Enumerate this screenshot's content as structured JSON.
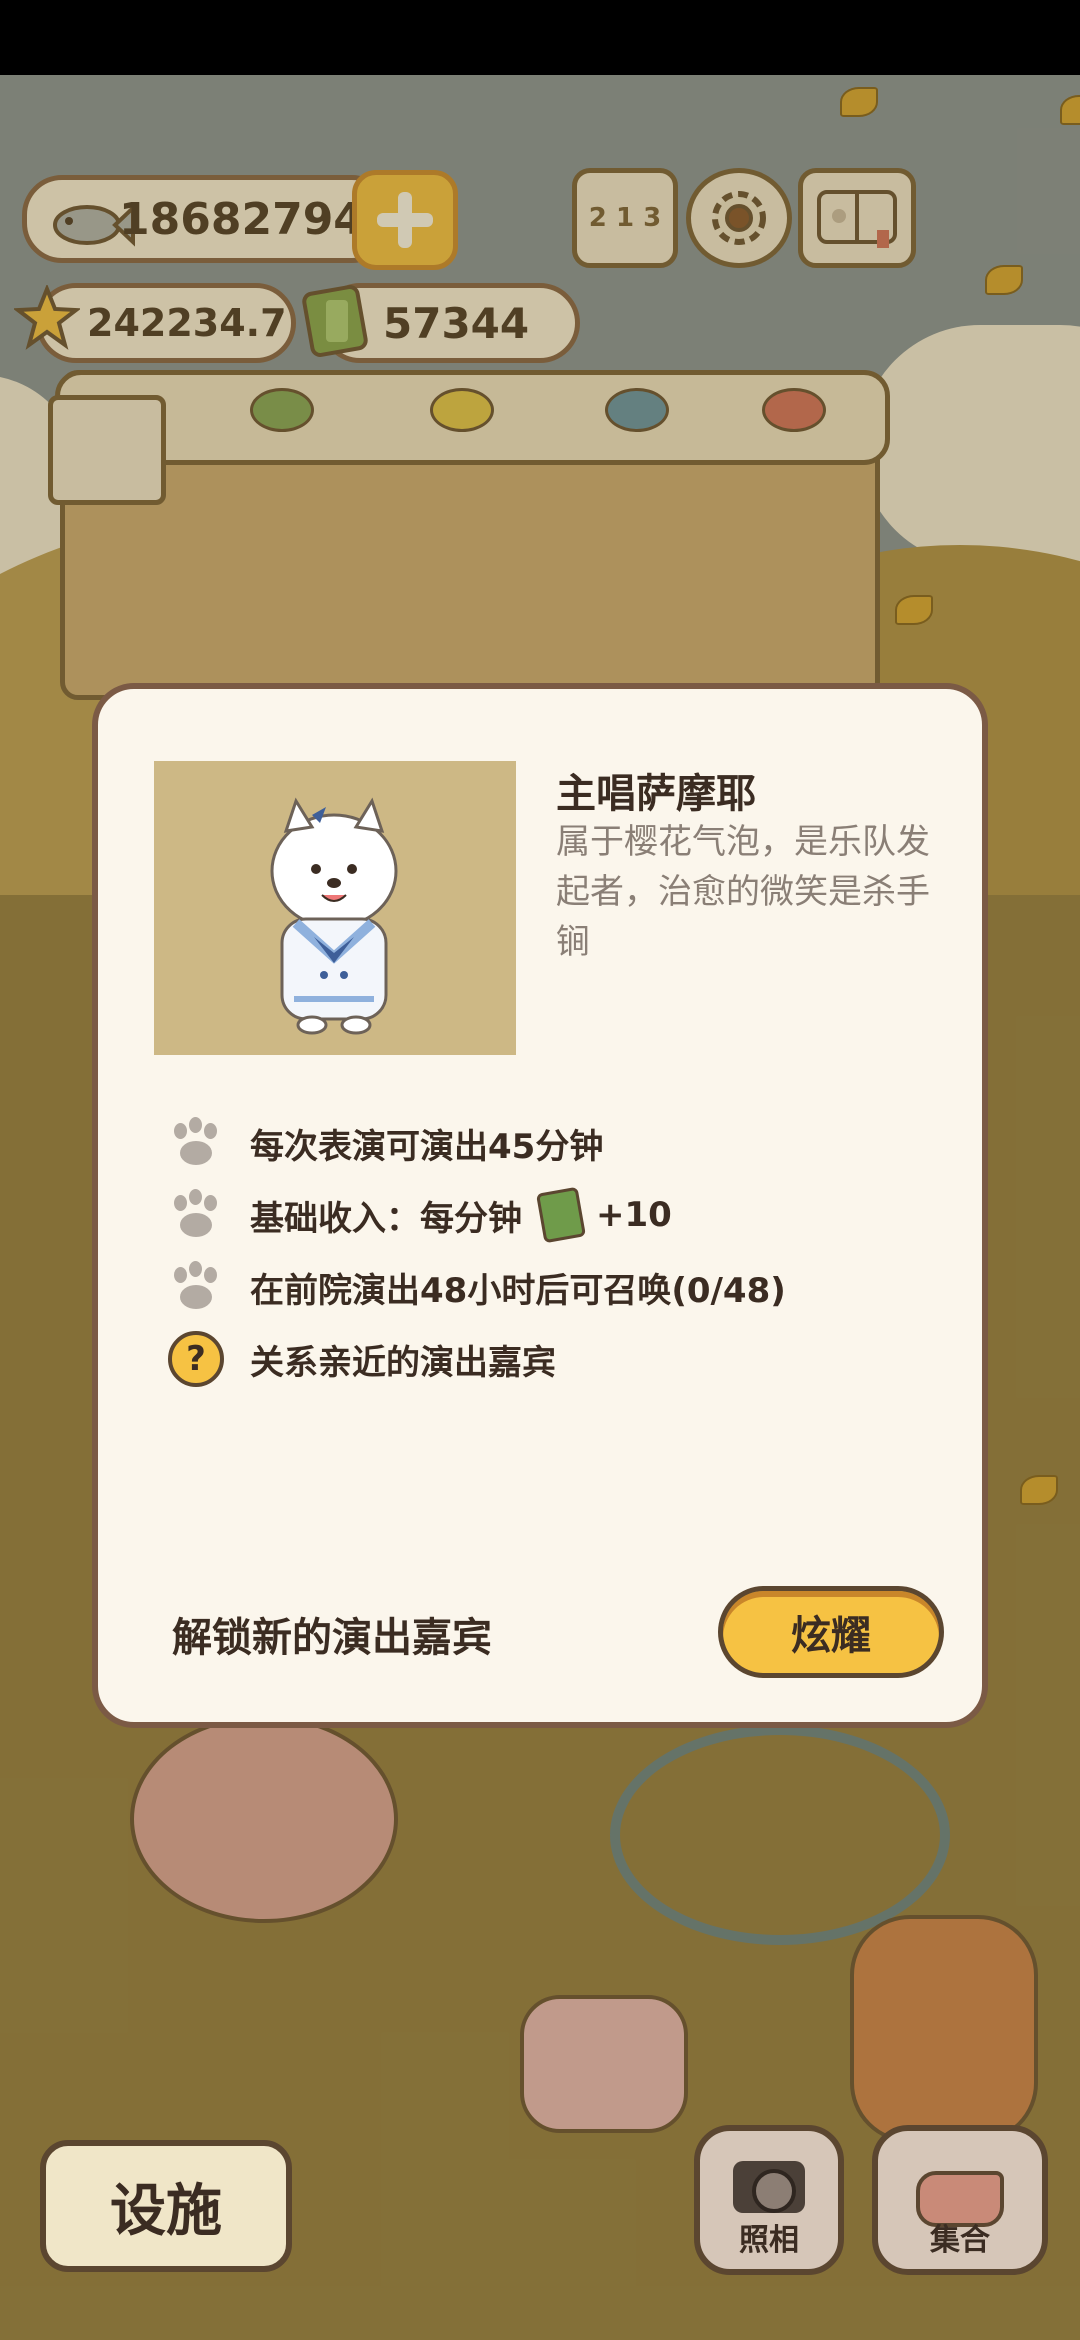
{
  "hud": {
    "fish_count": "18682794",
    "star_count": "242234.7",
    "ticket_count": "57344",
    "rank_icon_text": "2 1 3"
  },
  "modal": {
    "character_name": "主唱萨摩耶",
    "character_desc": "属于樱花气泡，是乐队发起者，治愈的微笑是杀手锏",
    "info_rows": [
      {
        "text": "每次表演可演出45分钟"
      },
      {
        "text": "基础收入：每分钟",
        "suffix": "+10"
      },
      {
        "text": "在前院演出48小时后可召唤(0/48)"
      },
      {
        "text": "关系亲近的演出嘉宾"
      }
    ],
    "help_icon": "?",
    "unlock_label": "解锁新的演出嘉宾",
    "show_button": "炫耀"
  },
  "bottom": {
    "facility_button": "设施",
    "photo_button": "照相",
    "gather_button": "集合"
  },
  "colors": {
    "accent_yellow": "#f6c243",
    "outline_brown": "#5b4630",
    "modal_bg": "#fbf6ec"
  }
}
